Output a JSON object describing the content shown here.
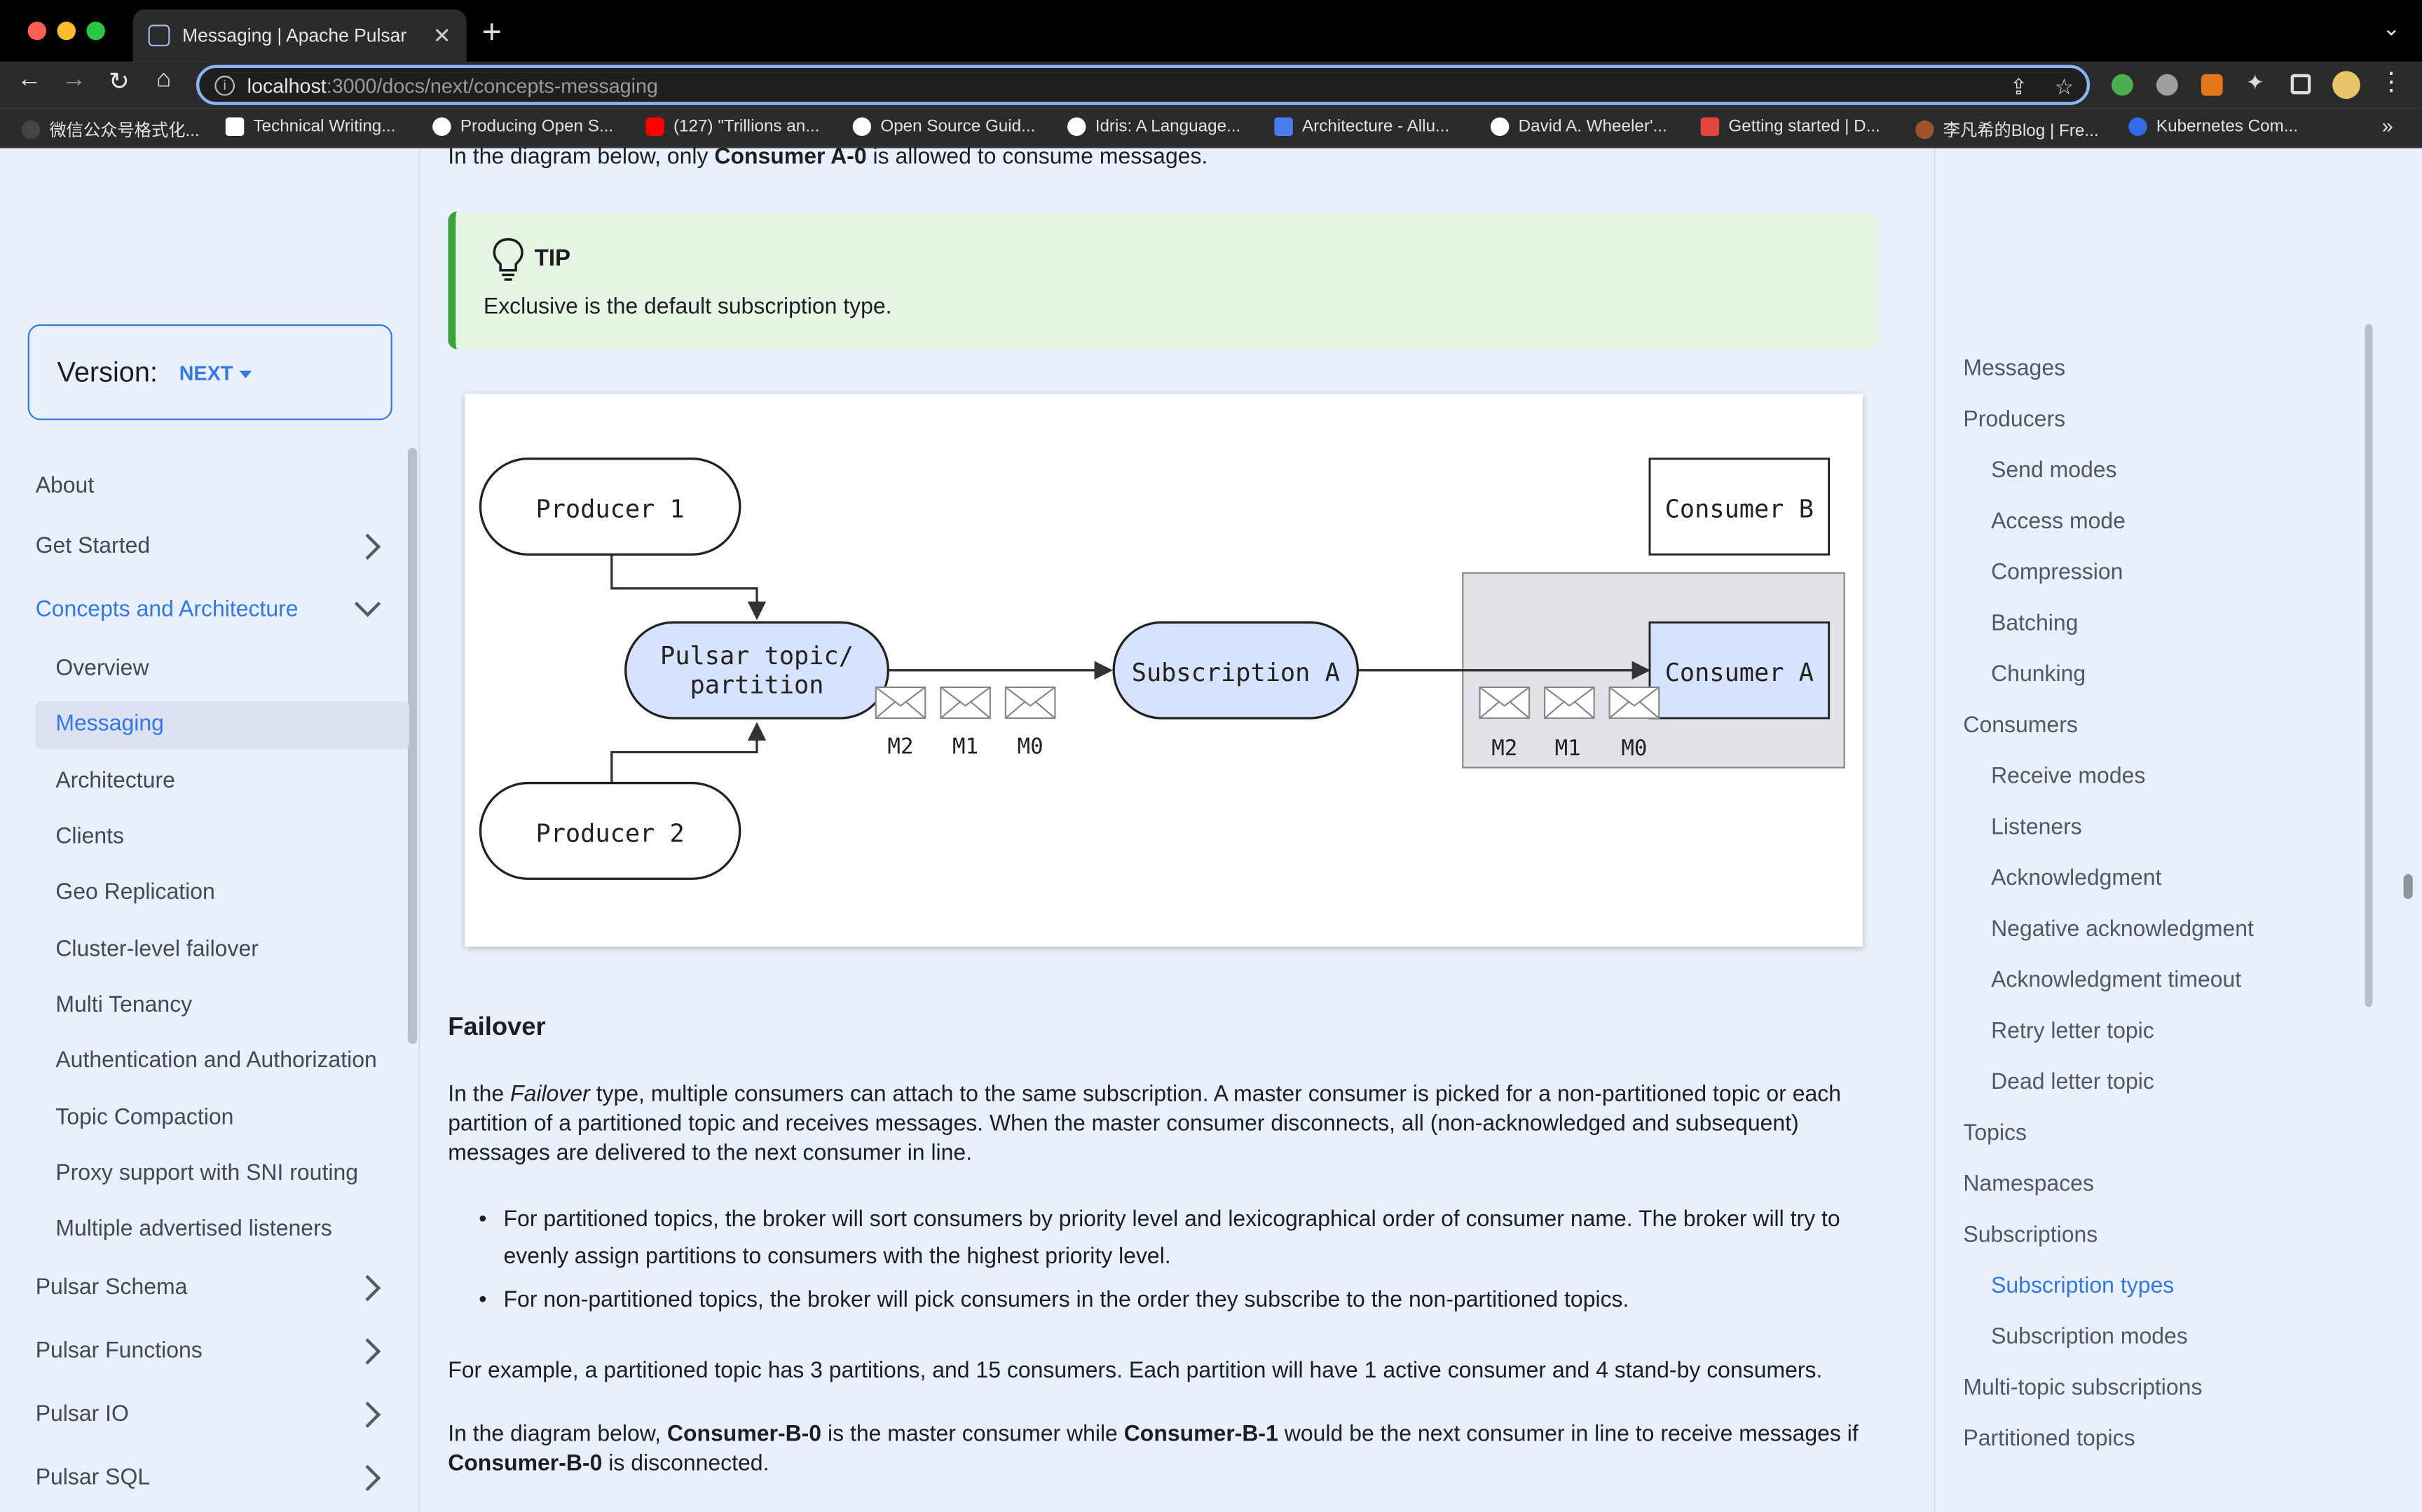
{
  "browser": {
    "tab_title": "Messaging | Apache Pulsar",
    "url_host": "localhost",
    "url_path": ":3000/docs/next/concepts-messaging",
    "bookmarks": [
      {
        "label": "微信公众号格式化...",
        "color": "#2b2b2b"
      },
      {
        "label": "Technical Writing...",
        "color": "#ffffff"
      },
      {
        "label": "Producing Open S...",
        "color": "#ffffff"
      },
      {
        "label": "(127) \"Trillions an...",
        "color": "#ff0000"
      },
      {
        "label": "Open Source Guid...",
        "color": "#ffffff"
      },
      {
        "label": "Idris: A Language...",
        "color": "#ffffff"
      },
      {
        "label": "Architecture - Allu...",
        "color": "#4a7cf0"
      },
      {
        "label": "David A. Wheeler'...",
        "color": "#ffffff"
      },
      {
        "label": "Getting started | D...",
        "color": "#e0463a"
      },
      {
        "label": "李凡希的Blog | Fre...",
        "color": "#a0522d"
      },
      {
        "label": "Kubernetes Com...",
        "color": "#326ce5"
      }
    ],
    "overflow": "»"
  },
  "sidebar": {
    "version_label": "Version:",
    "version_value": "NEXT",
    "items": [
      {
        "label": "About"
      },
      {
        "label": "Get Started"
      },
      {
        "label": "Concepts and Architecture"
      },
      {
        "label": "Overview"
      },
      {
        "label": "Messaging"
      },
      {
        "label": "Architecture"
      },
      {
        "label": "Clients"
      },
      {
        "label": "Geo Replication"
      },
      {
        "label": "Cluster-level failover"
      },
      {
        "label": "Multi Tenancy"
      },
      {
        "label": "Authentication and Authorization"
      },
      {
        "label": "Topic Compaction"
      },
      {
        "label": "Proxy support with SNI routing"
      },
      {
        "label": "Multiple advertised listeners"
      },
      {
        "label": "Pulsar Schema"
      },
      {
        "label": "Pulsar Functions"
      },
      {
        "label": "Pulsar IO"
      },
      {
        "label": "Pulsar SQL"
      }
    ]
  },
  "main": {
    "intro": {
      "pre": "In the diagram below, only ",
      "bold": "Consumer A-0",
      "post": " is allowed to consume messages."
    },
    "tip": {
      "title": "TIP",
      "body": "Exclusive is the default subscription type."
    },
    "diagram": {
      "producer1": "Producer 1",
      "producer2": "Producer 2",
      "topic_line1": "Pulsar topic/",
      "topic_line2": "partition",
      "subscription": "Subscription A",
      "consumer_a": "Consumer A",
      "consumer_b": "Consumer B",
      "messages": [
        "M2",
        "M1",
        "M0"
      ]
    },
    "failover": {
      "heading": "Failover",
      "p1_pre": "In the ",
      "p1_em": "Failover",
      "p1_post": " type, multiple consumers can attach to the same subscription. A master consumer is picked for a non-partitioned topic or each partition of a partitioned topic and receives messages. When the master consumer disconnects, all (non-acknowledged and subsequent) messages are delivered to the next consumer in line.",
      "bullet1": "For partitioned topics, the broker will sort consumers by priority level and lexicographical order of consumer name. The broker will try to evenly assign partitions to consumers with the highest priority level.",
      "bullet2": "For non-partitioned topics, the broker will pick consumers in the order they subscribe to the non-partitioned topics.",
      "p2": "For example, a partitioned topic has 3 partitions, and 15 consumers. Each partition will have 1 active consumer and 4 stand-by consumers.",
      "p3_pre": "In the diagram below, ",
      "p3_b1": "Consumer-B-0",
      "p3_mid": " is the master consumer while ",
      "p3_b2": "Consumer-B-1",
      "p3_post": " would be the next consumer in line to receive messages if ",
      "p3_b3": "Consumer-B-0",
      "p3_end": " is disconnected."
    }
  },
  "toc": {
    "items": [
      {
        "label": "Messages"
      },
      {
        "label": "Producers"
      },
      {
        "label": "Send modes"
      },
      {
        "label": "Access mode"
      },
      {
        "label": "Compression"
      },
      {
        "label": "Batching"
      },
      {
        "label": "Chunking"
      },
      {
        "label": "Consumers"
      },
      {
        "label": "Receive modes"
      },
      {
        "label": "Listeners"
      },
      {
        "label": "Acknowledgment"
      },
      {
        "label": "Negative acknowledgment"
      },
      {
        "label": "Acknowledgment timeout"
      },
      {
        "label": "Retry letter topic"
      },
      {
        "label": "Dead letter topic"
      },
      {
        "label": "Topics"
      },
      {
        "label": "Namespaces"
      },
      {
        "label": "Subscriptions"
      },
      {
        "label": "Subscription types"
      },
      {
        "label": "Subscription modes"
      },
      {
        "label": "Multi-topic subscriptions"
      },
      {
        "label": "Partitioned topics"
      }
    ]
  },
  "colors": {
    "accent": "#3578e5",
    "tip_border": "#3ba338",
    "tip_bg": "#e6f4e3",
    "node_fill": "#d7e3fc",
    "page_bg": "#e8f0fb"
  }
}
